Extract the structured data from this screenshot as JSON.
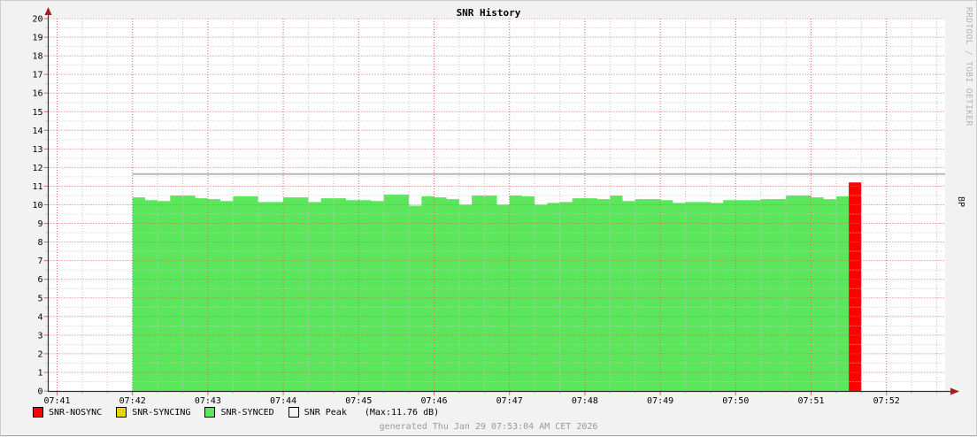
{
  "title": "SNR History",
  "watermark": "RRDTOOL / TOBI OETIKER",
  "right_axis_label": "BP",
  "footer": "generated Thu Jan 29 07:53:04 AM CET 2026",
  "legend": [
    {
      "label": "SNR-NOSYNC",
      "color": "#ff0000"
    },
    {
      "label": "SNR-SYNCING",
      "color": "#e8d400"
    },
    {
      "label": "SNR-SYNCED",
      "color": "#5ce65c"
    },
    {
      "label": "SNR Peak",
      "color": "#f4f4f4"
    }
  ],
  "legend_note": "(Max:11.76 dB)",
  "colors": {
    "background": "#f2f2f2",
    "plot_background": "#ffffff",
    "major_grid": "#d46a6a",
    "minor_grid": "#c9c9c9",
    "axis": "#333333",
    "arrow": "#a02020",
    "area_green": "#5ce65c",
    "bar_red": "#ff0000",
    "peak_line": "#b8b8b8",
    "text": "#000000",
    "footer_text": "#999999",
    "watermark_text": "#b4b4b4"
  },
  "chart_data": {
    "type": "area",
    "title": "SNR History",
    "unit": "dB",
    "ylabel_right": "BP",
    "ylim": [
      0,
      20
    ],
    "y_major_step": 1,
    "y_minor_step": 0.5,
    "x_axis_start": "07:41:00",
    "x_ticks": [
      "07:41",
      "07:42",
      "07:43",
      "07:44",
      "07:45",
      "07:46",
      "07:47",
      "07:48",
      "07:49",
      "07:50",
      "07:51",
      "07:52"
    ],
    "x_minor_seconds": 20,
    "x_major_seconds": 60,
    "grid": true,
    "legend_position": "bottom",
    "series": [
      {
        "name": "SNR-SYNCED",
        "style": "step-area",
        "color": "#5ce65c",
        "start": "07:42:00",
        "step_seconds": 10,
        "values": [
          10.4,
          10.25,
          10.2,
          10.5,
          10.5,
          10.35,
          10.3,
          10.2,
          10.45,
          10.45,
          10.15,
          10.15,
          10.4,
          10.4,
          10.15,
          10.35,
          10.35,
          10.25,
          10.25,
          10.2,
          10.55,
          10.55,
          9.95,
          10.45,
          10.4,
          10.3,
          10.0,
          10.5,
          10.5,
          10.0,
          10.5,
          10.45,
          10.0,
          10.1,
          10.15,
          10.35,
          10.35,
          10.3,
          10.5,
          10.2,
          10.3,
          10.3,
          10.25,
          10.1,
          10.15,
          10.15,
          10.1,
          10.25,
          10.25,
          10.25,
          10.3,
          10.3,
          10.5,
          10.5,
          10.4,
          10.3,
          10.45
        ]
      },
      {
        "name": "SNR-NOSYNC",
        "style": "step-area",
        "color": "#ff0000",
        "start": "07:51:30",
        "step_seconds": 10,
        "values": [
          11.2
        ]
      },
      {
        "name": "SNR Peak",
        "style": "hline",
        "color": "#b8b8b8",
        "value": 11.65,
        "from": "07:42:00",
        "to": "07:53:02",
        "max_label": "Max:11.76 dB"
      }
    ]
  }
}
